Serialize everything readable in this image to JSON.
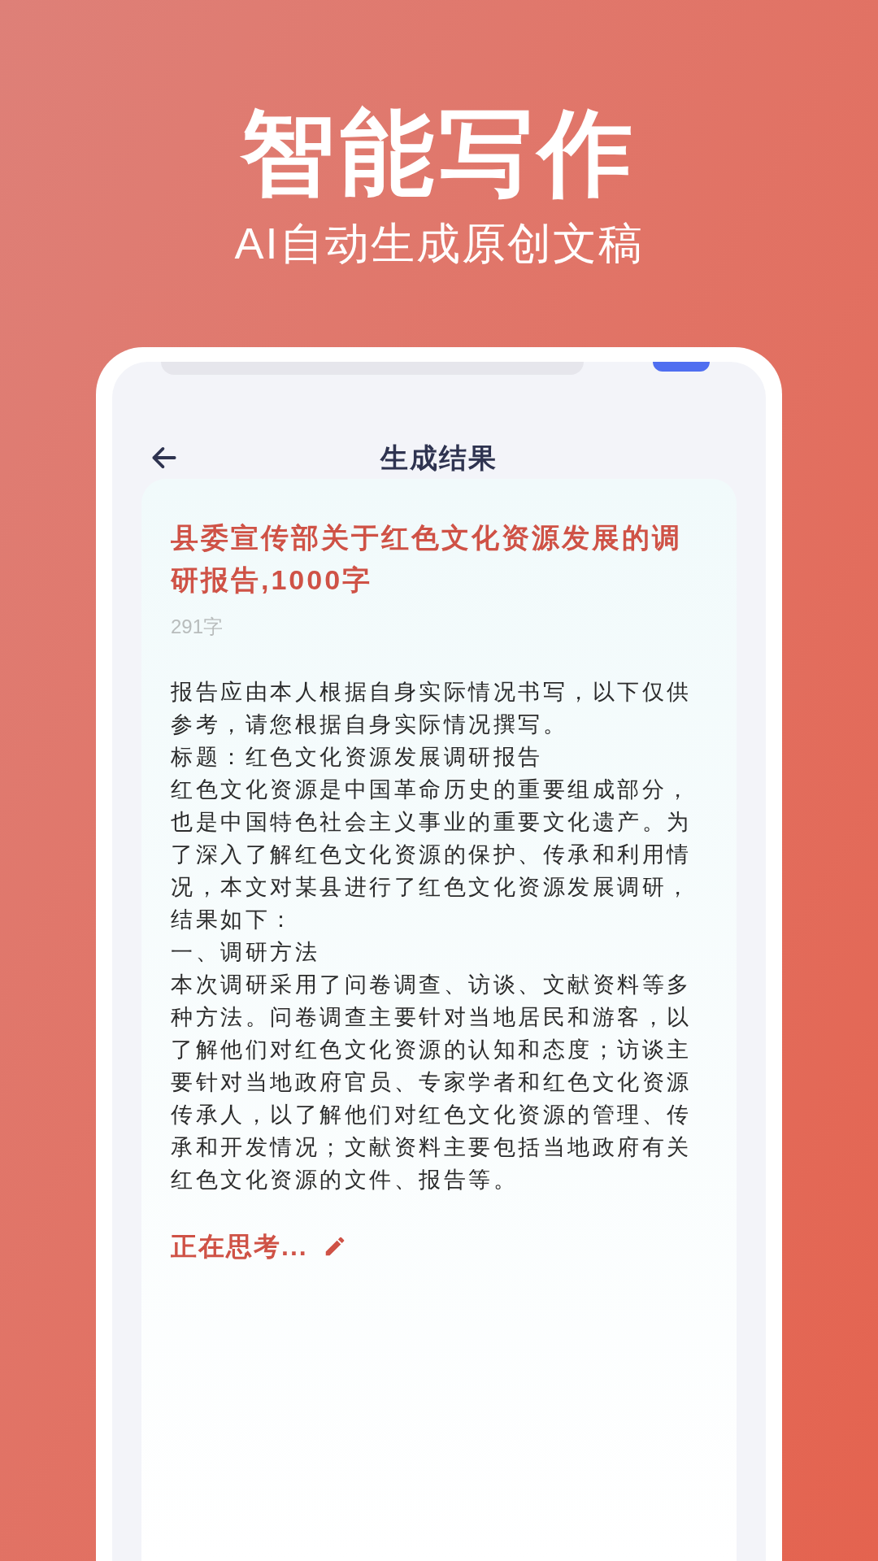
{
  "headline": "智能写作",
  "subtitle": "AI自动生成原创文稿",
  "screen": {
    "title": "生成结果",
    "result": {
      "title": "县委宣传部关于红色文化资源发展的调研报告,1000字",
      "word_count": "291字",
      "paragraphs": [
        "报告应由本人根据自身实际情况书写，以下仅供参考，请您根据自身实际情况撰写。",
        "标题：红色文化资源发展调研报告",
        "红色文化资源是中国革命历史的重要组成部分，也是中国特色社会主义事业的重要文化遗产。为了深入了解红色文化资源的保护、传承和利用情况，本文对某县进行了红色文化资源发展调研，结果如下：",
        "一、调研方法",
        "本次调研采用了问卷调查、访谈、文献资料等多种方法。问卷调查主要针对当地居民和游客，以了解他们对红色文化资源的认知和态度；访谈主要针对当地政府官员、专家学者和红色文化资源传承人，以了解他们对红色文化资源的管理、传承和开发情况；文献资料主要包括当地政府有关红色文化资源的文件、报告等。"
      ],
      "status": "正在思考..."
    }
  }
}
